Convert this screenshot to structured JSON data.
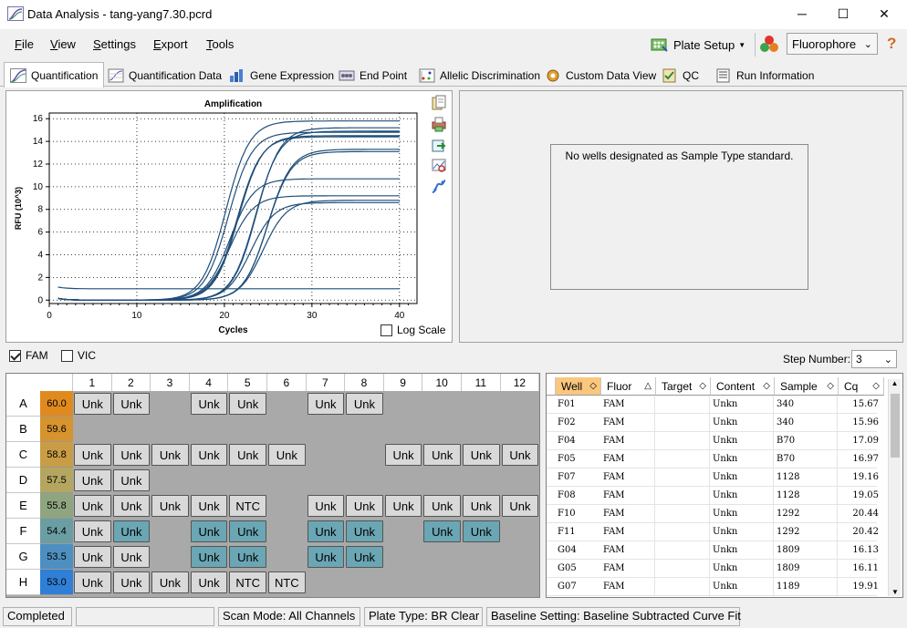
{
  "window": {
    "title": "Data Analysis - tang-yang7.30.pcrd",
    "minimize": "─",
    "maximize": "☐",
    "close": "✕"
  },
  "menu": {
    "file": "File",
    "view": "View",
    "settings": "Settings",
    "export": "Export",
    "tools": "Tools"
  },
  "toolbar": {
    "plate_setup": "Plate Setup",
    "fluorophore": "Fluorophore",
    "help": "?"
  },
  "tabs": [
    "Quantification",
    "Quantification Data",
    "Gene Expression",
    "End Point",
    "Allelic Discrimination",
    "Custom Data View",
    "QC",
    "Run Information"
  ],
  "chart": {
    "title": "Amplification",
    "xlabel": "Cycles",
    "ylabel": "RFU (10^3)",
    "log_scale": "Log Scale"
  },
  "chart_data": {
    "type": "line",
    "title": "Amplification",
    "xlabel": "Cycles",
    "ylabel": "RFU (10^3)",
    "xlim": [
      0,
      42
    ],
    "ylim": [
      -0.3,
      16.5
    ],
    "xticks": [
      0,
      10,
      20,
      30,
      40
    ],
    "yticks": [
      0,
      2,
      4,
      6,
      8,
      10,
      12,
      14,
      16
    ],
    "grid": true,
    "series": [
      {
        "cq": 15.67,
        "max": 15.8
      },
      {
        "cq": 15.96,
        "max": 14.8
      },
      {
        "cq": 17.09,
        "max": 14.5
      },
      {
        "cq": 16.97,
        "max": 14.4
      },
      {
        "cq": 19.16,
        "max": 15.2
      },
      {
        "cq": 19.05,
        "max": 14.9
      },
      {
        "cq": 20.44,
        "max": 13.3
      },
      {
        "cq": 20.42,
        "max": 13.1
      },
      {
        "cq": 16.13,
        "max": 10.7
      },
      {
        "cq": 16.11,
        "max": 9.2
      },
      {
        "cq": 19.91,
        "max": 8.8
      },
      {
        "cq": 18.5,
        "max": 8.6
      },
      {
        "cq": null,
        "max": 1.0
      }
    ]
  },
  "right_panel": {
    "message": "No wells designated as Sample Type standard."
  },
  "channels": {
    "fam": "FAM",
    "vic": "VIC",
    "step_label": "Step Number:",
    "step_value": "3"
  },
  "plate": {
    "columns": [
      "1",
      "2",
      "3",
      "4",
      "5",
      "6",
      "7",
      "8",
      "9",
      "10",
      "11",
      "12"
    ],
    "rows": [
      {
        "label": "A",
        "temp": "60.0",
        "color": "#e08a1e",
        "wells": [
          "Unk",
          "Unk",
          "",
          "Unk",
          "Unk",
          "",
          "Unk",
          "Unk",
          "",
          "",
          "",
          ""
        ]
      },
      {
        "label": "B",
        "temp": "59.6",
        "color": "#d6932e",
        "wells": [
          "",
          "",
          "",
          "",
          "",
          "",
          "",
          "",
          "",
          "",
          "",
          ""
        ]
      },
      {
        "label": "C",
        "temp": "58.8",
        "color": "#c99d45",
        "wells": [
          "Unk",
          "Unk",
          "Unk",
          "Unk",
          "Unk",
          "Unk",
          "",
          "",
          "Unk",
          "Unk",
          "Unk",
          "Unk"
        ]
      },
      {
        "label": "D",
        "temp": "57.5",
        "color": "#b4a660",
        "wells": [
          "Unk",
          "Unk",
          "",
          "",
          "",
          "",
          "",
          "",
          "",
          "",
          "",
          ""
        ]
      },
      {
        "label": "E",
        "temp": "55.8",
        "color": "#8fa57f",
        "wells": [
          "Unk",
          "Unk",
          "Unk",
          "Unk",
          "NTC",
          "",
          "Unk",
          "Unk",
          "Unk",
          "Unk",
          "Unk",
          "Unk"
        ]
      },
      {
        "label": "F",
        "temp": "54.4",
        "color": "#6a9ea3",
        "wells": [
          "Unk",
          "Unk",
          "",
          "Unk",
          "Unk",
          "",
          "Unk",
          "Unk",
          "",
          "Unk",
          "Unk",
          ""
        ]
      },
      {
        "label": "G",
        "temp": "53.5",
        "color": "#4d8fc0",
        "wells": [
          "Unk",
          "Unk",
          "",
          "Unk",
          "Unk",
          "",
          "Unk",
          "Unk",
          "",
          "",
          "",
          ""
        ]
      },
      {
        "label": "H",
        "temp": "53.0",
        "color": "#2f7fd6",
        "wells": [
          "Unk",
          "Unk",
          "Unk",
          "Unk",
          "NTC",
          "NTC",
          "",
          "",
          "",
          "",
          "",
          ""
        ]
      }
    ],
    "highlighted": [
      "F2",
      "F4",
      "F5",
      "F7",
      "F8",
      "F10",
      "F11",
      "G4",
      "G5",
      "G7",
      "G8"
    ]
  },
  "table": {
    "headers": [
      "Well",
      "Fluor",
      "Target",
      "Content",
      "Sample",
      "Cq"
    ],
    "rows": [
      [
        "F01",
        "FAM",
        "",
        "Unkn",
        "340",
        "15.67"
      ],
      [
        "F02",
        "FAM",
        "",
        "Unkn",
        "340",
        "15.96"
      ],
      [
        "F04",
        "FAM",
        "",
        "Unkn",
        "B70",
        "17.09"
      ],
      [
        "F05",
        "FAM",
        "",
        "Unkn",
        "B70",
        "16.97"
      ],
      [
        "F07",
        "FAM",
        "",
        "Unkn",
        "1128",
        "19.16"
      ],
      [
        "F08",
        "FAM",
        "",
        "Unkn",
        "1128",
        "19.05"
      ],
      [
        "F10",
        "FAM",
        "",
        "Unkn",
        "1292",
        "20.44"
      ],
      [
        "F11",
        "FAM",
        "",
        "Unkn",
        "1292",
        "20.42"
      ],
      [
        "G04",
        "FAM",
        "",
        "Unkn",
        "1809",
        "16.13"
      ],
      [
        "G05",
        "FAM",
        "",
        "Unkn",
        "1809",
        "16.11"
      ],
      [
        "G07",
        "FAM",
        "",
        "Unkn",
        "1189",
        "19.91"
      ]
    ]
  },
  "status": {
    "state": "Completed",
    "scan_mode": "Scan Mode: All Channels",
    "plate_type": "Plate Type: BR Clear",
    "baseline": "Baseline Setting: Baseline Subtracted Curve Fit"
  }
}
